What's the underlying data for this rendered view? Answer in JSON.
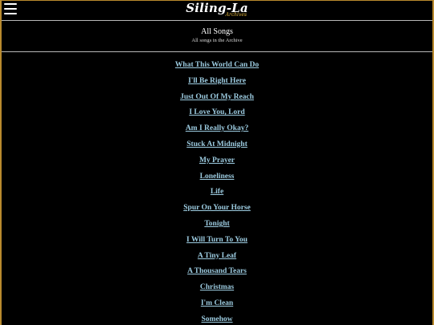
{
  "header": {
    "logo_text": "Siling-La",
    "logo_subtext": "Archives",
    "menu_icon": "hamburger-menu-icon"
  },
  "section": {
    "title": "All Songs",
    "subtitle": "All songs in the Archive"
  },
  "songs": [
    "What This World Can Do",
    "I'll Be Right Here",
    "Just Out Of My Reach",
    "I Love You, Lord",
    "Am I Really Okay?",
    "Stuck At Midnight",
    "My Prayer",
    "Loneliness",
    "Life",
    "Spur On Your Horse",
    "Tonight",
    "I Will Turn To You",
    "A Tiny Leaf",
    "A Thousand Tears",
    "Christmas",
    "I'm Clean",
    "Somehow"
  ],
  "colors": {
    "background": "#000000",
    "border_accent": "#b98a2e",
    "link": "#9ccbe0",
    "logo_sub": "#e0b23a"
  }
}
